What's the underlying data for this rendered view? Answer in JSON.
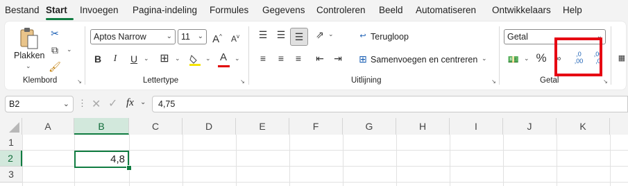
{
  "menu": {
    "tabs": [
      "Bestand",
      "Start",
      "Invoegen",
      "Pagina-indeling",
      "Formules",
      "Gegevens",
      "Controleren",
      "Beeld",
      "Automatiseren",
      "Ontwikkelaars",
      "Help"
    ],
    "active": "Start"
  },
  "ribbon": {
    "clipboard": {
      "paste_label": "Plakken",
      "group_label": "Klembord"
    },
    "font": {
      "font_name": "Aptos Narrow",
      "font_size": "11",
      "bold": "B",
      "italic": "I",
      "underline": "U",
      "grow": "A",
      "shrink": "A",
      "font_color": "A",
      "group_label": "Lettertype"
    },
    "alignment": {
      "wrap_label": "Terugloop",
      "merge_label": "Samenvoegen en centreren",
      "group_label": "Uitlijning"
    },
    "number": {
      "format": "Getal",
      "percent": "%",
      "increase_decimal": ",0 ,00",
      "decrease_decimal": ",00 ,0",
      "group_label": "Getal"
    }
  },
  "formula_bar": {
    "name_box": "B2",
    "fx": "fx",
    "value": "4,75"
  },
  "sheet": {
    "columns": [
      "A",
      "B",
      "C",
      "D",
      "E",
      "F",
      "G",
      "H",
      "I",
      "J",
      "K"
    ],
    "rows": [
      "1",
      "2",
      "3"
    ],
    "selected_cell": "B2",
    "cell_B2_display": "4,8"
  },
  "colors": {
    "accent": "#107c41",
    "highlight": "#e60012"
  }
}
